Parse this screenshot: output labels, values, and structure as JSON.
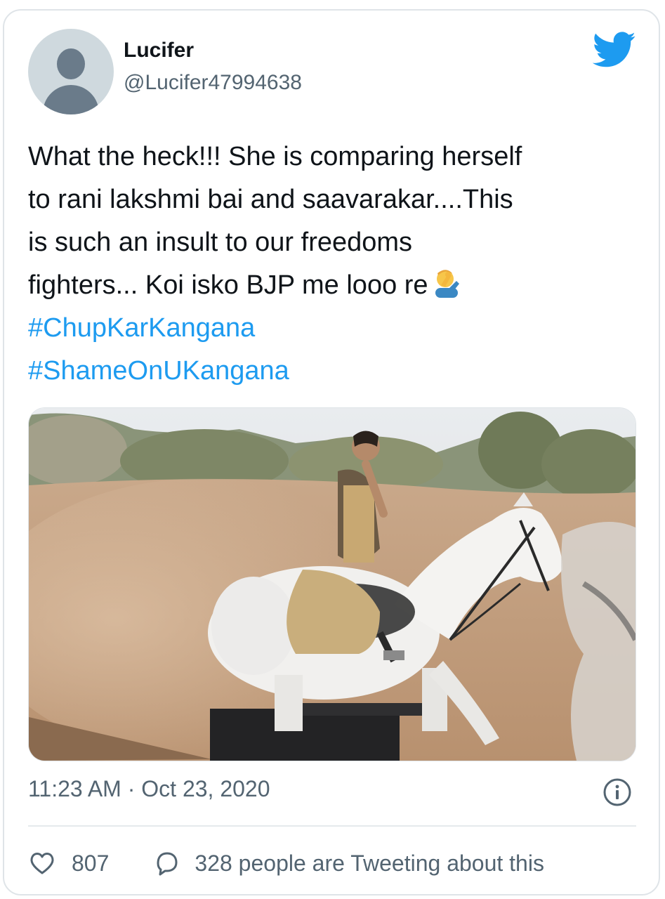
{
  "author": {
    "display_name": "Lucifer",
    "handle": "@Lucifer47994638"
  },
  "tweet": {
    "text_lines": [
      "What the heck!!! She is comparing herself",
      "to rani lakshmi bai and saavarakar....This",
      "is such an insult to our freedoms",
      "fighters... Koi isko BJP me looo re"
    ],
    "hashtags": [
      "#ChupKarKangana",
      "#ShameOnUKangana"
    ],
    "emoji": "facepalm-emoji"
  },
  "meta": {
    "time": "11:23 AM",
    "separator": "·",
    "date": "Oct 23, 2020"
  },
  "actions": {
    "likes": "807",
    "tweeting_text": "328 people are Tweeting about this"
  },
  "icons": {
    "brand": "twitter-bird-icon",
    "info": "info-icon",
    "like": "heart-icon",
    "reply": "speech-bubble-icon"
  },
  "colors": {
    "brand_blue": "#1d9bf0",
    "text_primary": "#0f1419",
    "text_secondary": "#536471",
    "border": "#dfe4e8"
  }
}
